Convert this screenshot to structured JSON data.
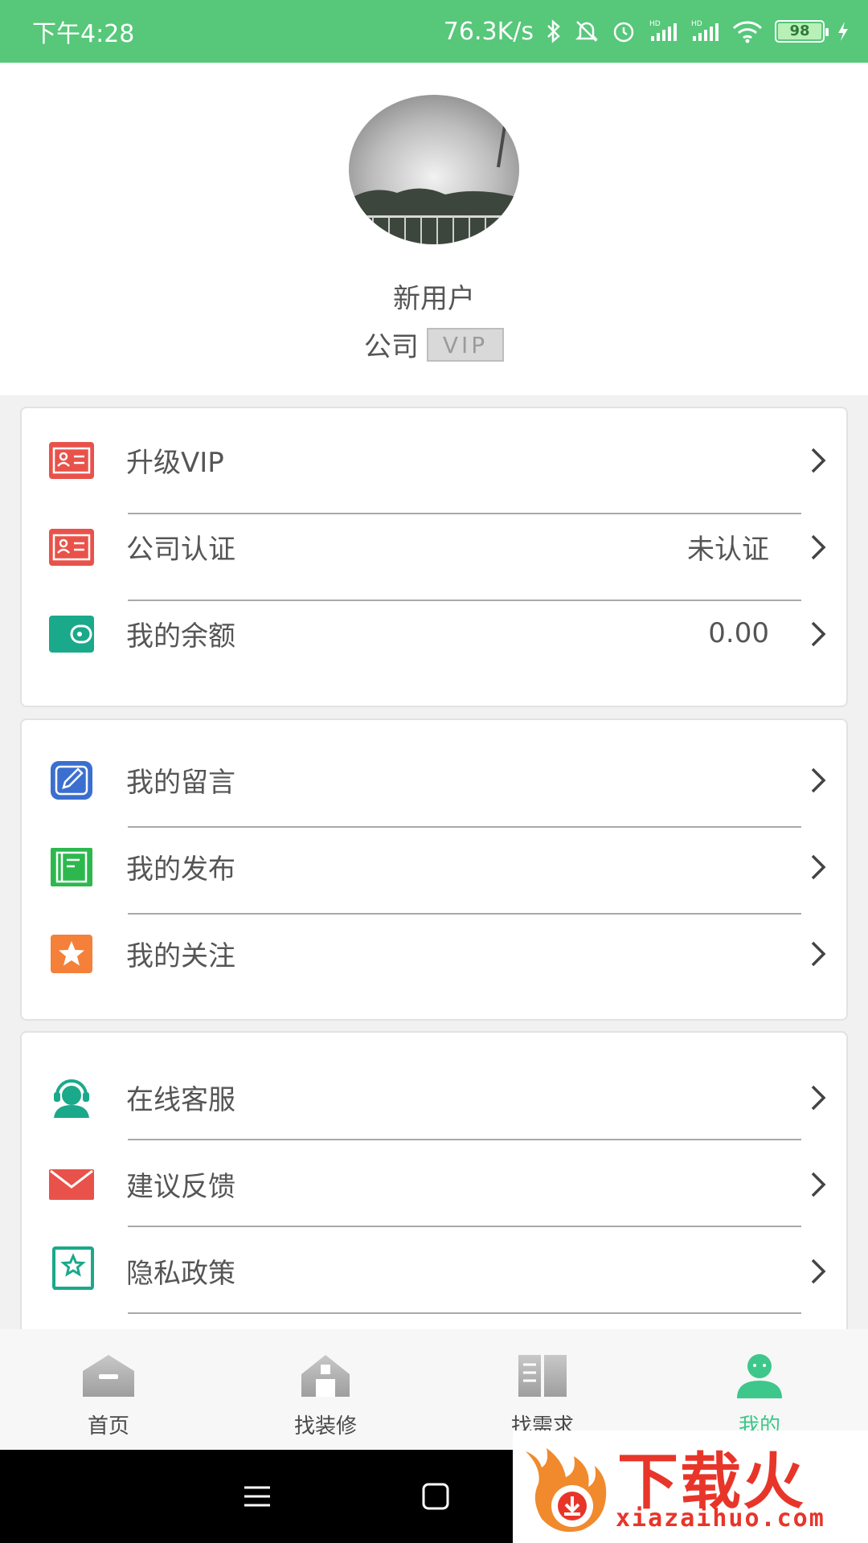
{
  "status_bar": {
    "time": "下午4:28",
    "net_speed": "76.3K/s",
    "battery": "98"
  },
  "profile": {
    "username": "新用户",
    "company": "公司",
    "vip_tag": "VIP"
  },
  "menu_groups": [
    {
      "items": [
        {
          "label": "升级VIP",
          "value": "",
          "icon": "id-card-icon",
          "color": "#e8524a"
        },
        {
          "label": "公司认证",
          "value": "未认证",
          "icon": "id-card-icon",
          "color": "#e8524a"
        },
        {
          "label": "我的余额",
          "value": "0.00",
          "icon": "wallet-icon",
          "color": "#1aa98a"
        }
      ]
    },
    {
      "items": [
        {
          "label": "我的留言",
          "value": "",
          "icon": "edit-icon",
          "color": "#3b6fcf"
        },
        {
          "label": "我的发布",
          "value": "",
          "icon": "notebook-icon",
          "color": "#2db84e"
        },
        {
          "label": "我的关注",
          "value": "",
          "icon": "star-icon",
          "color": "#f5803a"
        }
      ]
    },
    {
      "items": [
        {
          "label": "在线客服",
          "value": "",
          "icon": "customer-service-icon",
          "color": "#1aa98a"
        },
        {
          "label": "建议反馈",
          "value": "",
          "icon": "mail-icon",
          "color": "#e8524a"
        },
        {
          "label": "隐私政策",
          "value": "",
          "icon": "privacy-book-icon",
          "color": "#1aa98a"
        }
      ]
    }
  ],
  "tabs": [
    {
      "label": "首页",
      "icon": "home-icon",
      "active": false
    },
    {
      "label": "找装修",
      "icon": "house-icon",
      "active": false
    },
    {
      "label": "找需求",
      "icon": "book-icon",
      "active": false
    },
    {
      "label": "我的",
      "icon": "user-icon",
      "active": true
    }
  ],
  "colors": {
    "status_bar": "#57c77a",
    "active_tab": "#3ec78a"
  },
  "watermark": {
    "brand": "下载火",
    "url": "xiazaihuo.com"
  }
}
